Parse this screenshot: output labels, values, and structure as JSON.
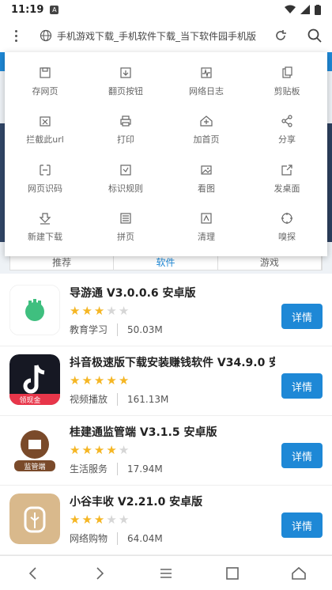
{
  "status": {
    "time": "11:19",
    "badge": "A"
  },
  "browser": {
    "url_text": "手机游戏下载_手机软件下载_当下软件园手机版"
  },
  "tabs_behind": [
    "推荐",
    "软件",
    "游戏"
  ],
  "menu": {
    "items": [
      {
        "label": "存网页",
        "icon": "save-icon"
      },
      {
        "label": "翻页按钮",
        "icon": "page-turn-icon"
      },
      {
        "label": "网络日志",
        "icon": "network-log-icon"
      },
      {
        "label": "剪贴板",
        "icon": "clipboard-icon"
      },
      {
        "label": "拦截此url",
        "icon": "block-url-icon"
      },
      {
        "label": "打印",
        "icon": "print-icon"
      },
      {
        "label": "加首页",
        "icon": "add-home-icon"
      },
      {
        "label": "分享",
        "icon": "share-icon"
      },
      {
        "label": "网页识码",
        "icon": "scan-code-icon"
      },
      {
        "label": "标识规则",
        "icon": "mark-rule-icon"
      },
      {
        "label": "看图",
        "icon": "view-image-icon"
      },
      {
        "label": "发桌面",
        "icon": "send-desktop-icon"
      },
      {
        "label": "新建下载",
        "icon": "new-download-icon"
      },
      {
        "label": "拼页",
        "icon": "merge-page-icon"
      },
      {
        "label": "清理",
        "icon": "clean-icon"
      },
      {
        "label": "嗅探",
        "icon": "sniff-icon"
      }
    ]
  },
  "apps": [
    {
      "name": "导游通 V3.0.0.6 安卓版",
      "rating": 3,
      "category": "教育学习",
      "size": "50.03M",
      "button": "详情",
      "icon_color": "#ffffff",
      "icon_label": ""
    },
    {
      "name": "抖音极速版下载安装赚钱软件 V34.9.0 安",
      "rating": 5,
      "category": "视频播放",
      "size": "161.13M",
      "button": "详情",
      "icon_color": "#1a1a1a",
      "icon_label": "领现金"
    },
    {
      "name": "桂建通监管端 V3.1.5 安卓版",
      "rating": 4,
      "category": "生活服务",
      "size": "17.94M",
      "button": "详情",
      "icon_color": "#ffffff",
      "icon_label": "监管端"
    },
    {
      "name": "小谷丰收 V2.21.0 安卓版",
      "rating": 3,
      "category": "网络购物",
      "size": "64.04M",
      "button": "详情",
      "icon_color": "#d9b98c",
      "icon_label": ""
    }
  ]
}
